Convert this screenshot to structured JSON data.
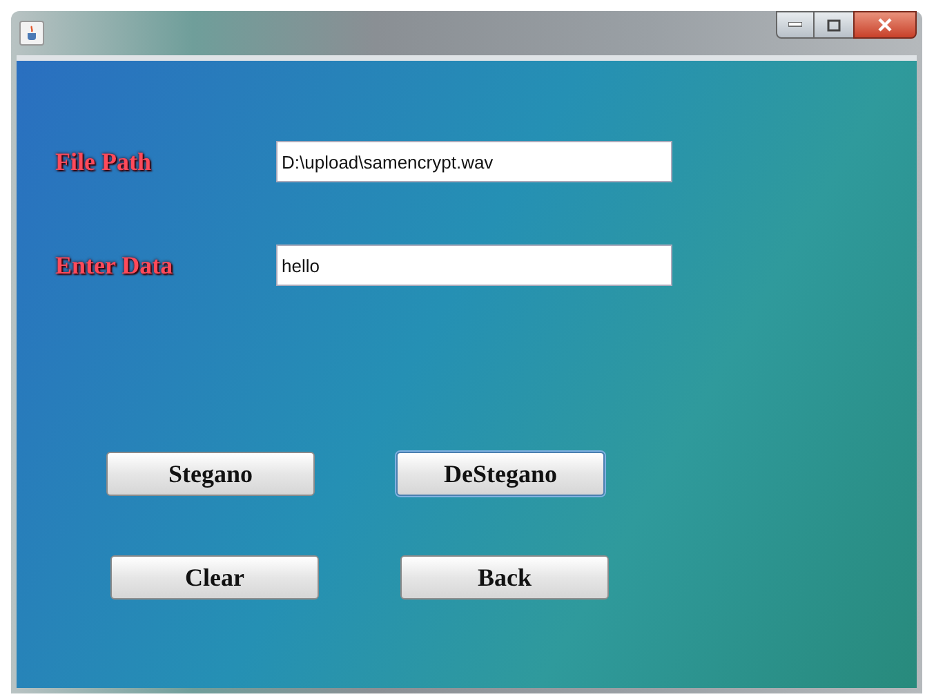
{
  "fields": [
    {
      "label": "File Path",
      "value": "D:\\upload\\samencrypt.wav"
    },
    {
      "label": "Enter Data",
      "value": "hello"
    }
  ],
  "buttons": [
    {
      "label": "Stegano",
      "focused": false
    },
    {
      "label": "DeStegano",
      "focused": true
    },
    {
      "label": "Clear",
      "focused": false
    },
    {
      "label": "Back",
      "focused": false
    }
  ]
}
